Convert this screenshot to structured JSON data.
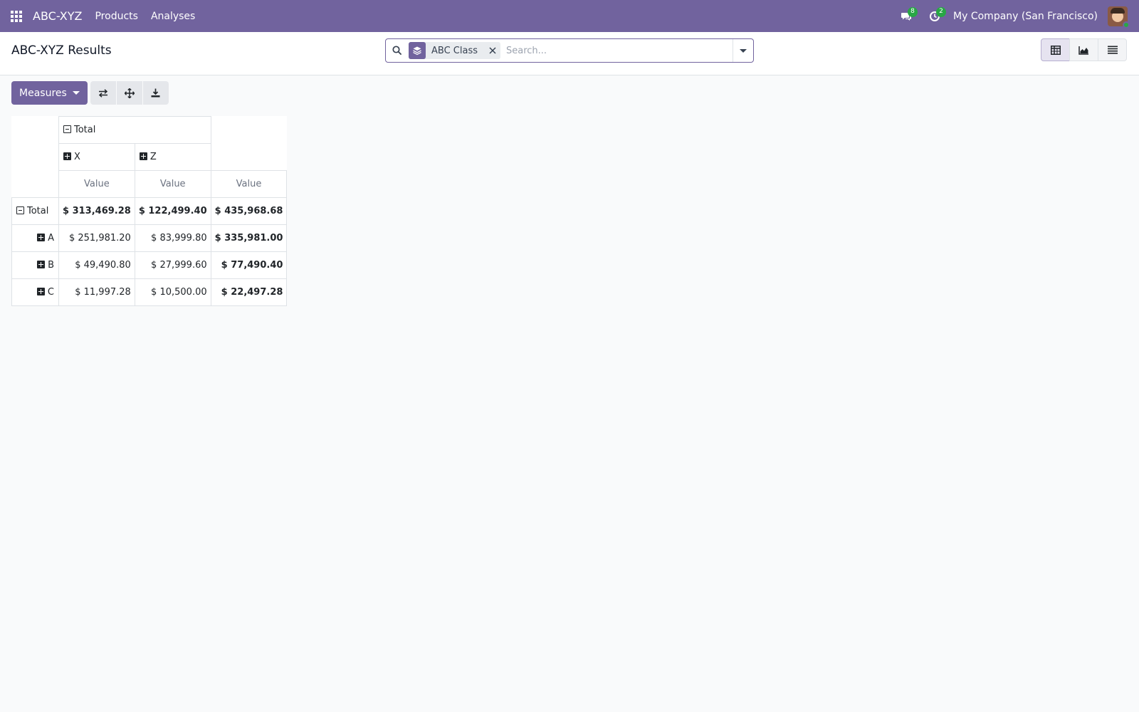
{
  "navbar": {
    "brand": "ABC-XYZ",
    "menu": [
      "Products",
      "Analyses"
    ],
    "messages_badge": "8",
    "activities_badge": "2",
    "company": "My Company (San Francisco)",
    "background": "#71639e"
  },
  "control_panel": {
    "title": "ABC-XYZ Results",
    "search": {
      "facet_label": "ABC Class",
      "facet_icon": "layers-icon",
      "placeholder": "Search..."
    },
    "views": [
      "pivot",
      "graph",
      "list"
    ],
    "active_view": "pivot"
  },
  "toolbar": {
    "measures_label": "Measures",
    "tools": [
      "flip-axis",
      "expand-all",
      "download-xlsx"
    ]
  },
  "pivot": {
    "col_total": "Total",
    "col_groups": [
      "X",
      "Z"
    ],
    "measure": "Value",
    "row_total": "Total",
    "totals": [
      "$ 313,469.28",
      "$ 122,499.40",
      "$ 435,968.68"
    ],
    "rows": [
      {
        "label": "A",
        "values": [
          "$ 251,981.20",
          "$ 83,999.80",
          "$ 335,981.00"
        ]
      },
      {
        "label": "B",
        "values": [
          "$ 49,490.80",
          "$ 27,999.60",
          "$ 77,490.40"
        ]
      },
      {
        "label": "C",
        "values": [
          "$ 11,997.28",
          "$ 10,500.00",
          "$ 22,497.28"
        ]
      }
    ]
  }
}
